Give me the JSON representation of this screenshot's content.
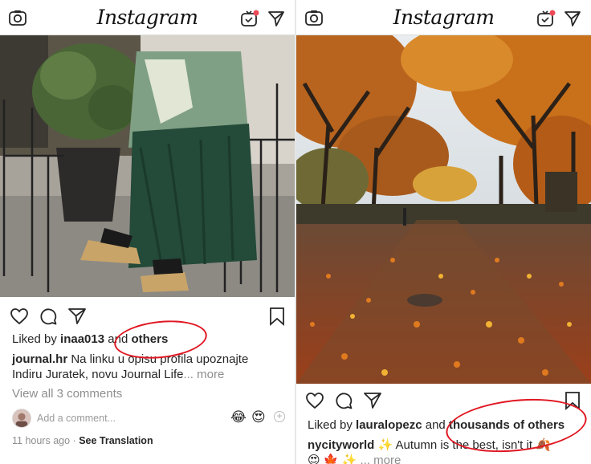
{
  "app": {
    "title": "Instagram",
    "camera_icon": "camera-icon",
    "igtv_icon": "igtv-icon",
    "direct_icon": "direct-message-icon"
  },
  "left_post": {
    "likes": {
      "prefix": "Liked by",
      "user": "inaa013",
      "joiner": "and",
      "others": "others"
    },
    "caption": {
      "user": "journal.hr",
      "line1": "Na linku u opisu profila upoznajte",
      "line2": "Indiru Juratek, novu Journal Life",
      "more": "... more"
    },
    "view_comments": "View all 3 comments",
    "add_comment_placeholder": "Add a comment...",
    "quick_emojis": [
      "😂",
      "😍"
    ],
    "timestamp": "11 hours ago",
    "separator": "·",
    "see_translation": "See Translation"
  },
  "right_post": {
    "likes": {
      "prefix": "Liked by",
      "user": "lauralopezc",
      "joiner": "and",
      "others": "thousands of others"
    },
    "caption": {
      "user": "nycityworld",
      "text": "✨ Autumn is the best, isn't it 🍂",
      "line2": "😍 🍁 ✨",
      "more": "... more"
    }
  },
  "colors": {
    "accent_circle": "#e01722",
    "text": "#262626",
    "muted": "#8e8e8e",
    "notification_dot": "#ed4956"
  }
}
